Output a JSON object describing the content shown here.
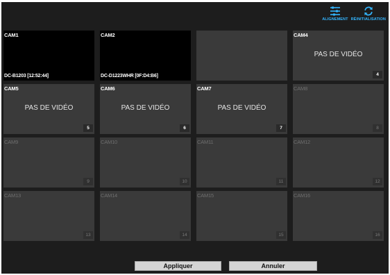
{
  "toolbar": {
    "align_label": "ALIGNEMENT",
    "reset_label": "RÉINITIALISATION",
    "accent": "#33b5ff"
  },
  "no_video_text": "PAS DE VIDÉO",
  "cameras": [
    {
      "name": "CAM1",
      "info": "DC-B1203 [12:52:44]",
      "number": ""
    },
    {
      "name": "CAM2",
      "info": "DC-D1223WHR [0F:D4:B6]",
      "number": ""
    },
    {
      "name": "",
      "info": "",
      "number": ""
    },
    {
      "name": "CAM4",
      "info": "",
      "number": "4"
    },
    {
      "name": "CAM5",
      "info": "",
      "number": "5"
    },
    {
      "name": "CAM6",
      "info": "",
      "number": "6"
    },
    {
      "name": "CAM7",
      "info": "",
      "number": "7"
    },
    {
      "name": "CAM8",
      "info": "",
      "number": "8"
    },
    {
      "name": "CAM9",
      "info": "",
      "number": "9"
    },
    {
      "name": "CAM10",
      "info": "",
      "number": "10"
    },
    {
      "name": "CAM11",
      "info": "",
      "number": "11"
    },
    {
      "name": "CAM12",
      "info": "",
      "number": "12"
    },
    {
      "name": "CAM13",
      "info": "",
      "number": "13"
    },
    {
      "name": "CAM14",
      "info": "",
      "number": "14"
    },
    {
      "name": "CAM15",
      "info": "",
      "number": "15"
    },
    {
      "name": "CAM16",
      "info": "",
      "number": "16"
    }
  ],
  "buttons": {
    "apply": "Appliquer",
    "cancel": "Annuler"
  }
}
